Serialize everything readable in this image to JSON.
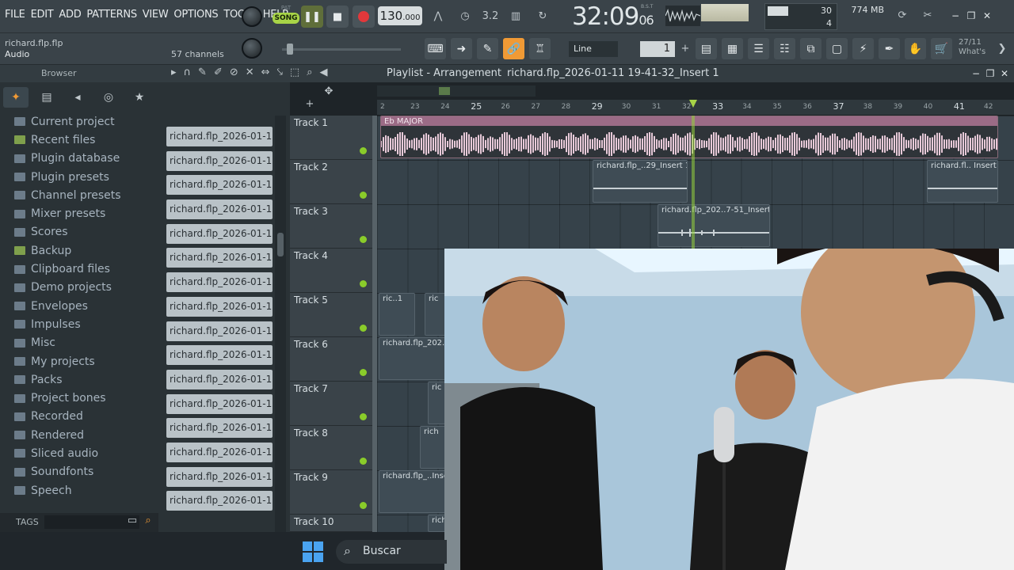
{
  "menu": [
    "FILE",
    "EDIT",
    "ADD",
    "PATTERNS",
    "VIEW",
    "OPTIONS",
    "TOOLS",
    "HELP"
  ],
  "transport": {
    "pat_label": "PAT",
    "song_label": "SONG",
    "tempo": "130",
    "tempo_frac": ".000",
    "time_main": "32:09",
    "time_ticks": "06",
    "time_unit": "B.S.T"
  },
  "cpu": {
    "value": "30",
    "poly": "4"
  },
  "memory": "774 MB",
  "project": {
    "file": "richard.flp.flp",
    "mode": "Audio",
    "channels": "57 channels"
  },
  "snap": "Line",
  "pattern_number": "1",
  "news": {
    "date": "27/11",
    "text": "What's"
  },
  "browser": {
    "title": "Browser",
    "folders": [
      "Current project",
      "Recent files",
      "Plugin database",
      "Plugin presets",
      "Channel presets",
      "Mixer presets",
      "Scores",
      "Backup",
      "Clipboard files",
      "Demo projects",
      "Envelopes",
      "Impulses",
      "Misc",
      "My projects",
      "Packs",
      "Project bones",
      "Recorded",
      "Rendered",
      "Sliced audio",
      "Soundfonts",
      "Speech"
    ],
    "files": [
      "richard.flp_2026-01-11...",
      "richard.flp_2026-01-11...",
      "richard.flp_2026-01-11...",
      "richard.flp_2026-01-11...",
      "richard.flp_2026-01-11...",
      "richard.flp_2026-01-11...",
      "richard.flp_2026-01-11...",
      "richard.flp_2026-01-11...",
      "richard.flp_2026-01-11...",
      "richard.flp_2026-01-11...",
      "richard.flp_2026-01-11...",
      "richard.flp_2026-01-11...",
      "richard.flp_2026-01-11...",
      "richard.flp_2026-01-11...",
      "richard.flp_2026-01-11...",
      "richard.flp_2026-01-11..."
    ],
    "tags_label": "TAGS"
  },
  "playlist": {
    "title": "Playlist - Arrangement",
    "path": "richard.flp_2026-01-11 19-41-32_Insert 1",
    "ruler": [
      "2",
      "23",
      "24",
      "25",
      "26",
      "27",
      "28",
      "29",
      "30",
      "31",
      "32",
      "33",
      "34",
      "35",
      "36",
      "37",
      "38",
      "39",
      "40",
      "41",
      "42"
    ],
    "tracks": [
      "Track 1",
      "Track 2",
      "Track 3",
      "Track 4",
      "Track 5",
      "Track 6",
      "Track 7",
      "Track 8",
      "Track 9",
      "Track 10"
    ],
    "clips": {
      "main": "Eb MAJOR",
      "t2a": "richard.flp_..29_Insert 1",
      "t2b": "richard.fl.. Insert 1",
      "t3": "richard.flp_202..7-51_Insert 1",
      "t5a": "ric..1",
      "t5b": "ric",
      "t6": "richard.flp_202..",
      "t7": "ric",
      "t8": "rich",
      "t9": "richard.flp_..Inse",
      "t10": "rich"
    }
  },
  "taskbar": {
    "search": "Buscar"
  },
  "colors": {
    "accent": "#f09a35",
    "song": "#a8d447",
    "led": "#8acc2a",
    "main_clip": "#9b6b86"
  }
}
